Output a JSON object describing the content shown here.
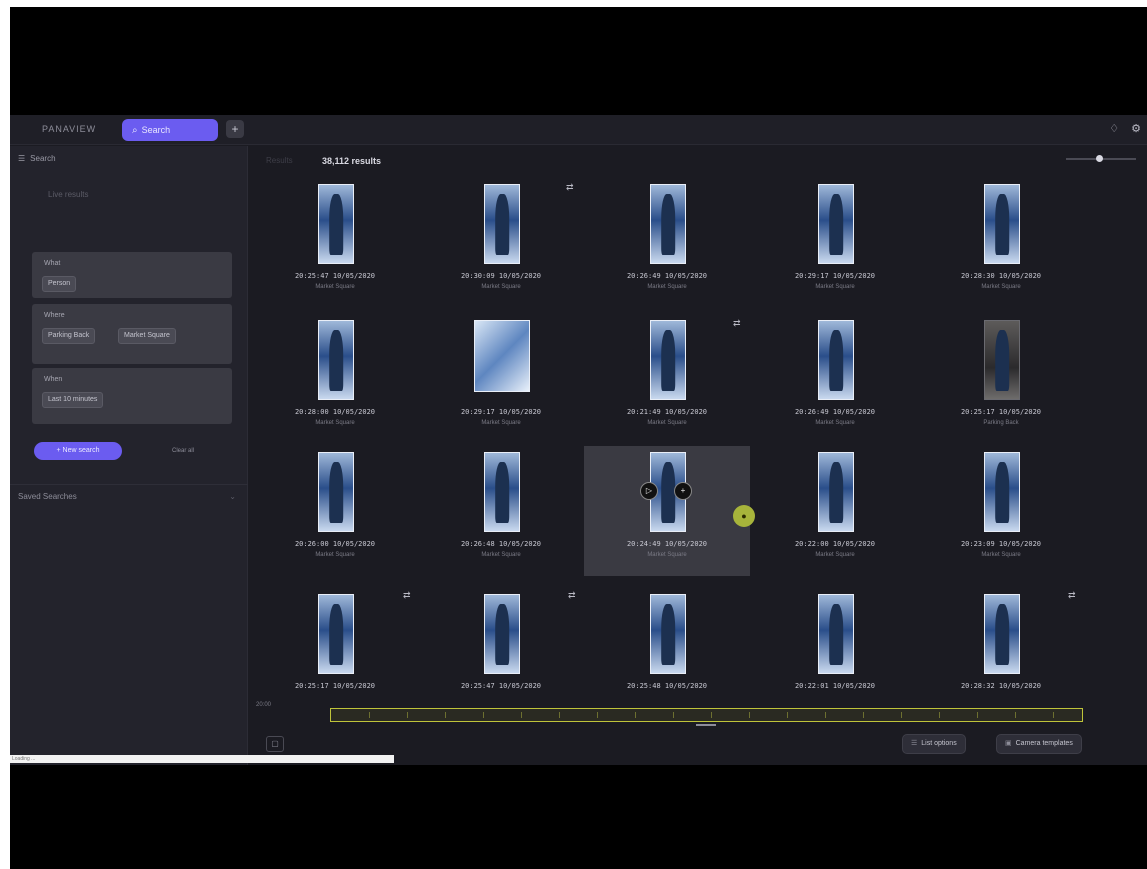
{
  "topbar": {
    "brand": "PANAVIEW",
    "search_label": "Search",
    "search_icon": "search-icon",
    "add_icon": "plus-icon",
    "right_icons": [
      "bell-icon",
      "settings-icon"
    ]
  },
  "sidebar": {
    "header": "Search",
    "sub": "Live results",
    "filters": [
      {
        "title": "What",
        "chips": [
          "Person"
        ]
      },
      {
        "title": "Where",
        "chips": [
          "Parking Back",
          "Market Square"
        ]
      },
      {
        "title": "When",
        "chips": [
          "Last 10 minutes"
        ]
      }
    ],
    "new_search": "+ New search",
    "clear_all": "Clear all",
    "saved": "Saved Searches"
  },
  "main": {
    "results_prefix": "Results",
    "results_count": "38,112 results",
    "cards": [
      {
        "ts": "20:25:47 10/05/2020",
        "cam": "Market Square"
      },
      {
        "ts": "20:30:09 10/05/2020",
        "cam": "Market Square"
      },
      {
        "ts": "20:26:49 10/05/2020",
        "cam": "Market Square"
      },
      {
        "ts": "20:29:17 10/05/2020",
        "cam": "Market Square"
      },
      {
        "ts": "20:28:30 10/05/2020",
        "cam": "Market Square"
      },
      {
        "ts": "20:28:00 10/05/2020",
        "cam": "Market Square"
      },
      {
        "ts": "20:29:17 10/05/2020",
        "cam": "Market Square"
      },
      {
        "ts": "20:21:49 10/05/2020",
        "cam": "Market Square"
      },
      {
        "ts": "20:26:49 10/05/2020",
        "cam": "Market Square"
      },
      {
        "ts": "20:25:17 10/05/2020",
        "cam": "Parking Back"
      },
      {
        "ts": "20:26:00 10/05/2020",
        "cam": "Market Square"
      },
      {
        "ts": "20:26:48 10/05/2020",
        "cam": "Market Square"
      },
      {
        "ts": "20:24:49 10/05/2020",
        "cam": "Market Square"
      },
      {
        "ts": "20:22:00 10/05/2020",
        "cam": "Market Square"
      },
      {
        "ts": "20:23:09 10/05/2020",
        "cam": "Market Square"
      },
      {
        "ts": "20:25:17 10/05/2020",
        "cam": ""
      },
      {
        "ts": "20:25:47 10/05/2020",
        "cam": ""
      },
      {
        "ts": "20:25:48 10/05/2020",
        "cam": ""
      },
      {
        "ts": "20:22:01 10/05/2020",
        "cam": ""
      },
      {
        "ts": "20:28:32 10/05/2020",
        "cam": ""
      }
    ]
  },
  "timeline": {
    "label": "20:00"
  },
  "bottom": {
    "list_options": "List options",
    "camera_templates": "Camera templates"
  },
  "progress": {
    "text": "Loading ..."
  }
}
